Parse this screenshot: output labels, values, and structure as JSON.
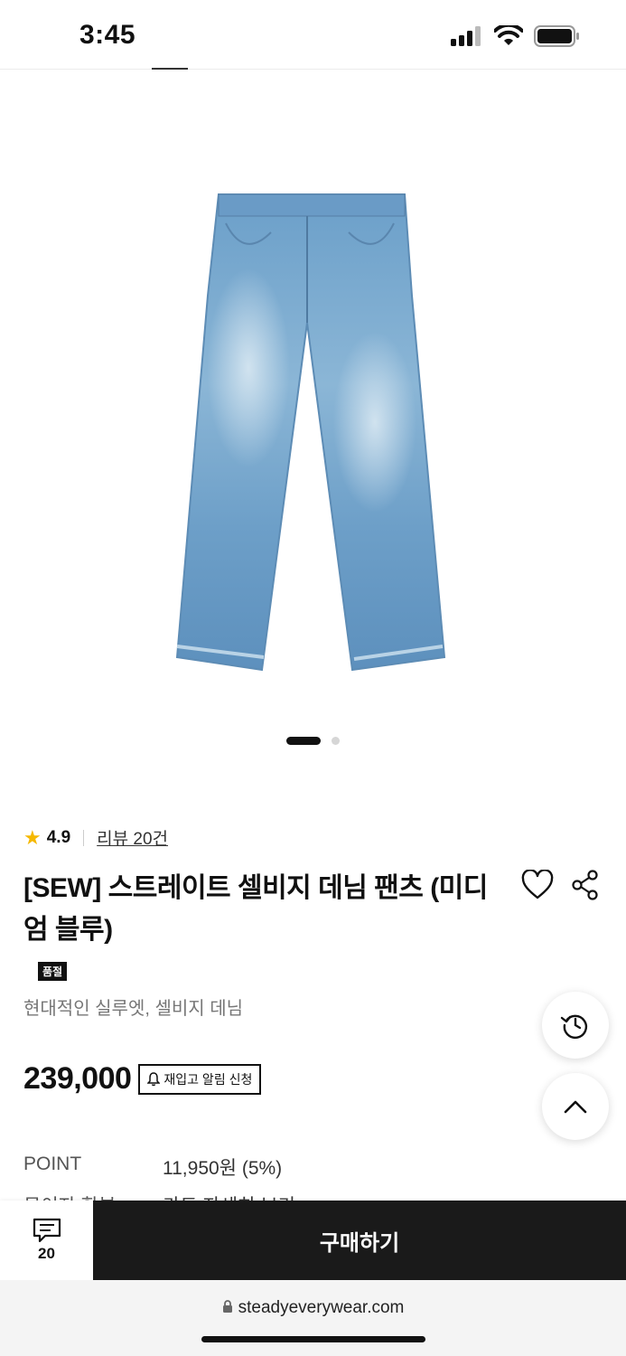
{
  "status": {
    "time": "3:45"
  },
  "gallery": {
    "slide_count": 2,
    "active_slide": 1
  },
  "product": {
    "rating": "4.9",
    "review_link": "리뷰 20건",
    "title": "[SEW] 스트레이트 셀비지 데님 팬츠 (미디엄 블루)",
    "badge": "품절",
    "subtitle": "현대적인 실루엣, 셀비지 데님",
    "price": "239,000",
    "restock_label": "재입고 알림 신청",
    "point_label": "POINT",
    "point_value": "11,950원 (5%)",
    "next_label": "무이자 할부",
    "next_value": "카드 자세히 보기"
  },
  "bottom": {
    "chat_count": "20",
    "buy_label": "구매하기"
  },
  "browser": {
    "url": "steadyeverywear.com"
  },
  "icons": {
    "star": "star-icon",
    "heart": "heart-icon",
    "share": "share-icon",
    "bell": "bell-icon",
    "history": "history-icon",
    "up": "chevron-up-icon",
    "chat": "chat-icon",
    "lock": "lock-icon"
  },
  "colors": {
    "accent": "#f5b800",
    "buy_button": "#1a1a1a"
  }
}
